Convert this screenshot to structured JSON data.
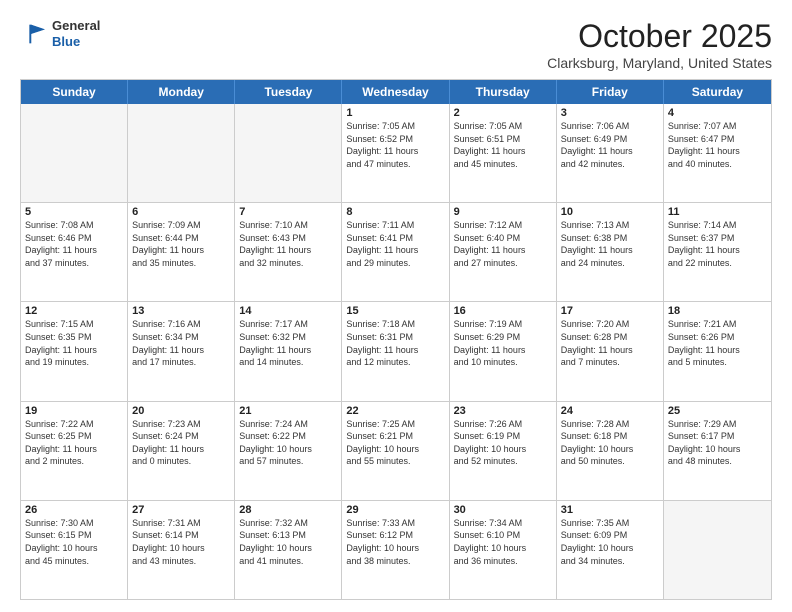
{
  "header": {
    "logo": {
      "general": "General",
      "blue": "Blue"
    },
    "title": "October 2025",
    "location": "Clarksburg, Maryland, United States"
  },
  "weekdays": [
    "Sunday",
    "Monday",
    "Tuesday",
    "Wednesday",
    "Thursday",
    "Friday",
    "Saturday"
  ],
  "rows": [
    [
      {
        "day": "",
        "info": ""
      },
      {
        "day": "",
        "info": ""
      },
      {
        "day": "",
        "info": ""
      },
      {
        "day": "1",
        "info": "Sunrise: 7:05 AM\nSunset: 6:52 PM\nDaylight: 11 hours\nand 47 minutes."
      },
      {
        "day": "2",
        "info": "Sunrise: 7:05 AM\nSunset: 6:51 PM\nDaylight: 11 hours\nand 45 minutes."
      },
      {
        "day": "3",
        "info": "Sunrise: 7:06 AM\nSunset: 6:49 PM\nDaylight: 11 hours\nand 42 minutes."
      },
      {
        "day": "4",
        "info": "Sunrise: 7:07 AM\nSunset: 6:47 PM\nDaylight: 11 hours\nand 40 minutes."
      }
    ],
    [
      {
        "day": "5",
        "info": "Sunrise: 7:08 AM\nSunset: 6:46 PM\nDaylight: 11 hours\nand 37 minutes."
      },
      {
        "day": "6",
        "info": "Sunrise: 7:09 AM\nSunset: 6:44 PM\nDaylight: 11 hours\nand 35 minutes."
      },
      {
        "day": "7",
        "info": "Sunrise: 7:10 AM\nSunset: 6:43 PM\nDaylight: 11 hours\nand 32 minutes."
      },
      {
        "day": "8",
        "info": "Sunrise: 7:11 AM\nSunset: 6:41 PM\nDaylight: 11 hours\nand 29 minutes."
      },
      {
        "day": "9",
        "info": "Sunrise: 7:12 AM\nSunset: 6:40 PM\nDaylight: 11 hours\nand 27 minutes."
      },
      {
        "day": "10",
        "info": "Sunrise: 7:13 AM\nSunset: 6:38 PM\nDaylight: 11 hours\nand 24 minutes."
      },
      {
        "day": "11",
        "info": "Sunrise: 7:14 AM\nSunset: 6:37 PM\nDaylight: 11 hours\nand 22 minutes."
      }
    ],
    [
      {
        "day": "12",
        "info": "Sunrise: 7:15 AM\nSunset: 6:35 PM\nDaylight: 11 hours\nand 19 minutes."
      },
      {
        "day": "13",
        "info": "Sunrise: 7:16 AM\nSunset: 6:34 PM\nDaylight: 11 hours\nand 17 minutes."
      },
      {
        "day": "14",
        "info": "Sunrise: 7:17 AM\nSunset: 6:32 PM\nDaylight: 11 hours\nand 14 minutes."
      },
      {
        "day": "15",
        "info": "Sunrise: 7:18 AM\nSunset: 6:31 PM\nDaylight: 11 hours\nand 12 minutes."
      },
      {
        "day": "16",
        "info": "Sunrise: 7:19 AM\nSunset: 6:29 PM\nDaylight: 11 hours\nand 10 minutes."
      },
      {
        "day": "17",
        "info": "Sunrise: 7:20 AM\nSunset: 6:28 PM\nDaylight: 11 hours\nand 7 minutes."
      },
      {
        "day": "18",
        "info": "Sunrise: 7:21 AM\nSunset: 6:26 PM\nDaylight: 11 hours\nand 5 minutes."
      }
    ],
    [
      {
        "day": "19",
        "info": "Sunrise: 7:22 AM\nSunset: 6:25 PM\nDaylight: 11 hours\nand 2 minutes."
      },
      {
        "day": "20",
        "info": "Sunrise: 7:23 AM\nSunset: 6:24 PM\nDaylight: 11 hours\nand 0 minutes."
      },
      {
        "day": "21",
        "info": "Sunrise: 7:24 AM\nSunset: 6:22 PM\nDaylight: 10 hours\nand 57 minutes."
      },
      {
        "day": "22",
        "info": "Sunrise: 7:25 AM\nSunset: 6:21 PM\nDaylight: 10 hours\nand 55 minutes."
      },
      {
        "day": "23",
        "info": "Sunrise: 7:26 AM\nSunset: 6:19 PM\nDaylight: 10 hours\nand 52 minutes."
      },
      {
        "day": "24",
        "info": "Sunrise: 7:28 AM\nSunset: 6:18 PM\nDaylight: 10 hours\nand 50 minutes."
      },
      {
        "day": "25",
        "info": "Sunrise: 7:29 AM\nSunset: 6:17 PM\nDaylight: 10 hours\nand 48 minutes."
      }
    ],
    [
      {
        "day": "26",
        "info": "Sunrise: 7:30 AM\nSunset: 6:15 PM\nDaylight: 10 hours\nand 45 minutes."
      },
      {
        "day": "27",
        "info": "Sunrise: 7:31 AM\nSunset: 6:14 PM\nDaylight: 10 hours\nand 43 minutes."
      },
      {
        "day": "28",
        "info": "Sunrise: 7:32 AM\nSunset: 6:13 PM\nDaylight: 10 hours\nand 41 minutes."
      },
      {
        "day": "29",
        "info": "Sunrise: 7:33 AM\nSunset: 6:12 PM\nDaylight: 10 hours\nand 38 minutes."
      },
      {
        "day": "30",
        "info": "Sunrise: 7:34 AM\nSunset: 6:10 PM\nDaylight: 10 hours\nand 36 minutes."
      },
      {
        "day": "31",
        "info": "Sunrise: 7:35 AM\nSunset: 6:09 PM\nDaylight: 10 hours\nand 34 minutes."
      },
      {
        "day": "",
        "info": ""
      }
    ]
  ]
}
